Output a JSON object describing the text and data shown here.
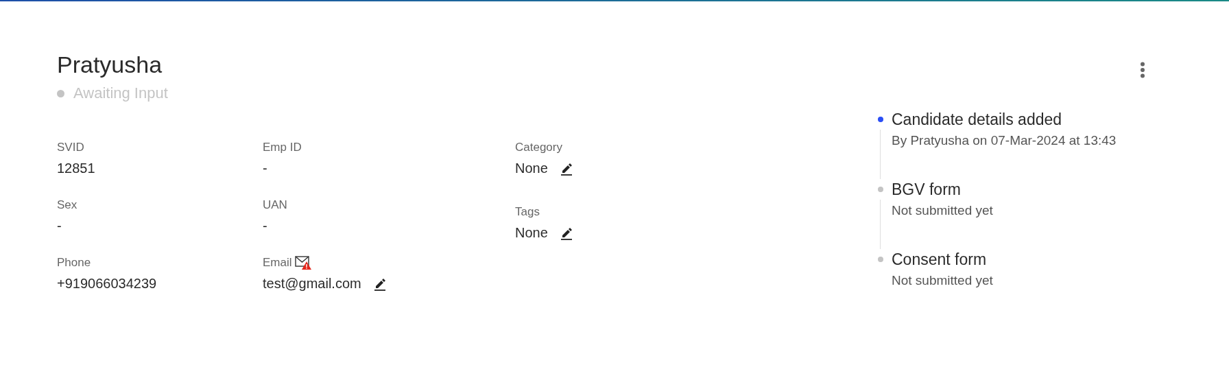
{
  "candidate": {
    "name": "Pratyusha",
    "status": {
      "label": "Awaiting Input",
      "color": "#c4c4c4"
    }
  },
  "columns": [
    {
      "fields": [
        {
          "label": "SVID",
          "value": "12851",
          "editable": false,
          "warning": false
        },
        {
          "label": "Sex",
          "value": "-",
          "editable": false,
          "warning": false
        },
        {
          "label": "Phone",
          "value": "+919066034239",
          "editable": false,
          "warning": false
        }
      ]
    },
    {
      "fields": [
        {
          "label": "Emp ID",
          "value": "-",
          "editable": false,
          "warning": false
        },
        {
          "label": "UAN",
          "value": "-",
          "editable": false,
          "warning": false
        },
        {
          "label": "Email",
          "value": "test@gmail.com",
          "editable": true,
          "warning": true
        }
      ]
    },
    {
      "fields": [
        {
          "label": "Category",
          "value": "None",
          "editable": true,
          "warning": false
        },
        {
          "label": "Tags",
          "value": "None",
          "editable": true,
          "warning": false
        }
      ]
    }
  ],
  "timeline": [
    {
      "title": "Candidate details added",
      "detail": "By Pratyusha on 07-Mar-2024 at 13:43",
      "done": true
    },
    {
      "title": "BGV form",
      "detail": "Not submitted yet",
      "done": false
    },
    {
      "title": "Consent form",
      "detail": "Not submitted yet",
      "done": false
    }
  ]
}
